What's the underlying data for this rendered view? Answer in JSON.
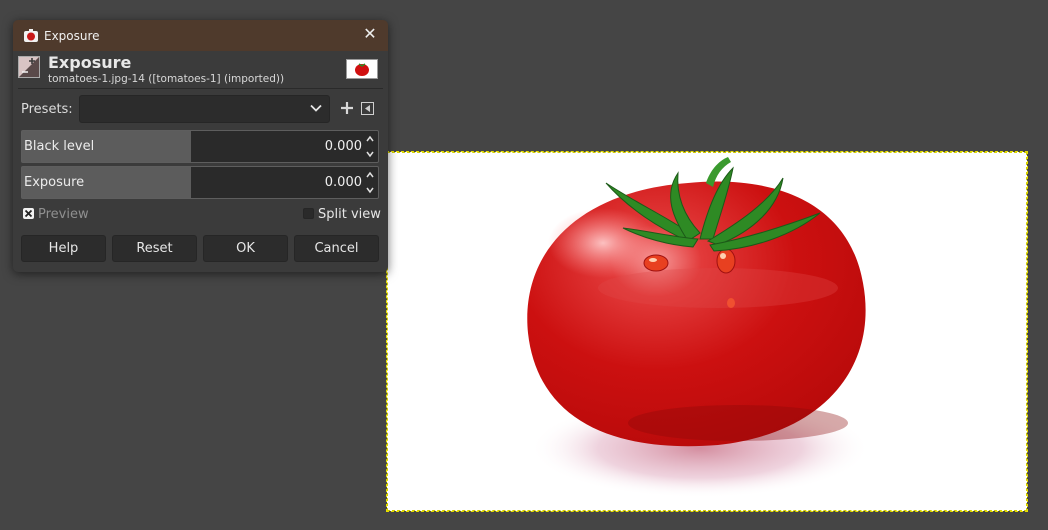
{
  "dialog": {
    "window_title": "Exposure",
    "icon": "gimp-app-icon",
    "heading": "Exposure",
    "subheading": "tomatoes-1.jpg-14 ([tomatoes-1] (imported))",
    "presets": {
      "label": "Presets:",
      "value": "",
      "add_icon": "plus-icon",
      "menu_icon": "menu-arrow-icon"
    },
    "black_level": {
      "label": "Black level",
      "value": "0.000"
    },
    "exposure": {
      "label": "Exposure",
      "value": "0.000"
    },
    "preview": {
      "label": "Preview",
      "checked": true
    },
    "split_view": {
      "label": "Split view",
      "checked": false
    },
    "buttons": {
      "help": "Help",
      "reset": "Reset",
      "ok": "OK",
      "cancel": "Cancel"
    }
  },
  "canvas": {
    "image": "tomato"
  },
  "colors": {
    "background": "#454545",
    "titlebar": "#4f3a2c",
    "dialog": "#3b3b3b",
    "tomato_red": "#d01010",
    "stem_green": "#2e8a24"
  }
}
